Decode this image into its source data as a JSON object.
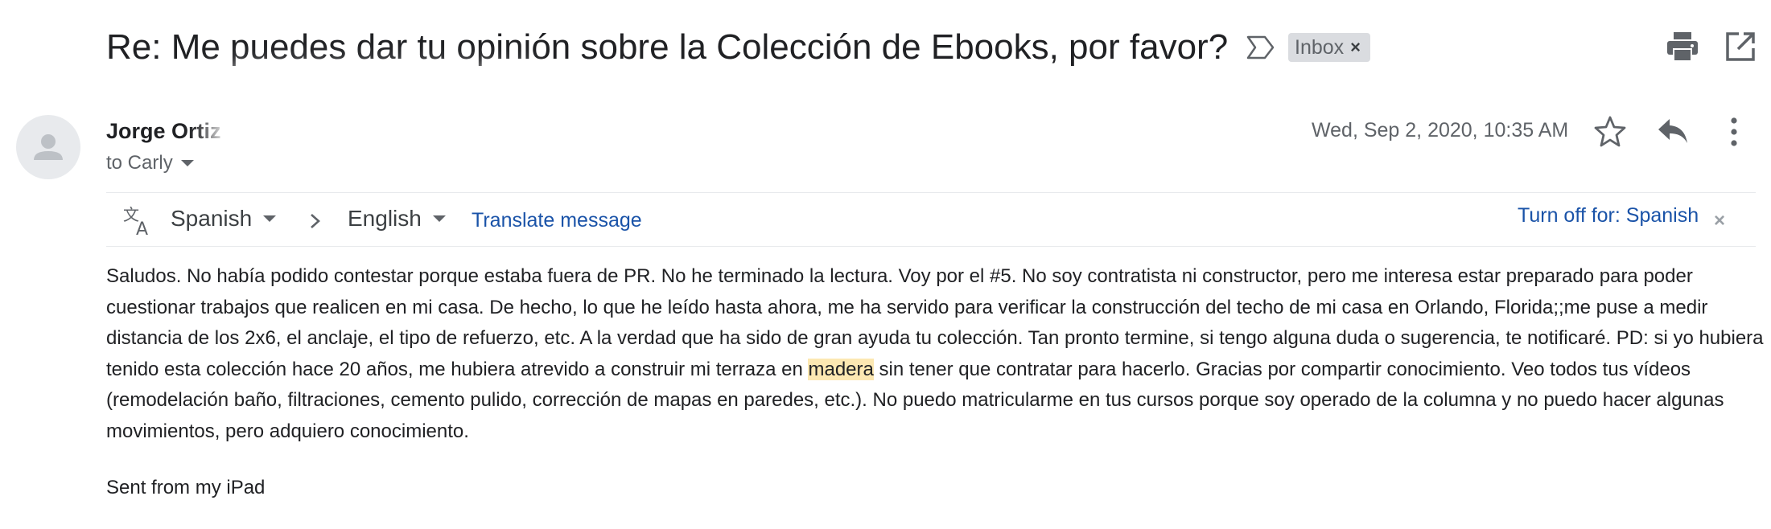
{
  "subject": "Re: Me puedes dar tu opinión sobre la Colección de Ebooks, por favor?",
  "labels": {
    "inbox": "Inbox",
    "remove": "×"
  },
  "icons": {
    "important": "important-marker-icon",
    "print": "print-icon",
    "popout": "open-in-new-window-icon",
    "avatar": "person-icon",
    "star": "star-icon",
    "reply": "reply-icon",
    "more": "more-vert-icon",
    "translate": "translate-icon"
  },
  "sender": {
    "name": "Jorge Ortiz",
    "recipient": "to Carly"
  },
  "date": "Wed, Sep 2, 2020, 10:35 AM",
  "translate_bar": {
    "source_language": "Spanish",
    "target_language": "English",
    "translate_link": "Translate message",
    "turn_off_link": "Turn off for: Spanish",
    "close": "×"
  },
  "body": {
    "before_highlight": "Saludos.  No había podido contestar porque estaba fuera de PR.   No he terminado la lectura.  Voy por el #5.   No soy contratista ni constructor, pero me interesa estar preparado para poder cuestionar trabajos que realicen en mi casa.  De hecho, lo que he leído hasta ahora, me ha servido para verificar la construcción del techo de mi casa en Orlando, Florida;;me puse a medir distancia de los 2x6, el anclaje, el tipo de refuerzo, etc.   A la verdad que ha sido de gran ayuda tu colección.  Tan pronto termine, si tengo alguna duda o sugerencia, te notificaré.    PD:  si yo hubiera tenido esta colección hace 20 años, me hubiera atrevido a construir mi terraza en ",
    "highlight": "madera",
    "after_highlight": " sin tener que contratar para hacerlo.  Gracias por compartir conocimiento.  Veo todos tus vídeos (remodelación baño, filtraciones, cemento pulido, corrección de mapas en paredes, etc.).  No puedo matricularme en tus cursos porque soy operado de la columna y no puedo hacer algunas movimientos, pero adquiero conocimiento.",
    "signature": "Sent from my iPad"
  },
  "colors": {
    "link": "#1a53a8",
    "label_bg": "#dadce0",
    "highlight": "#fce8b2"
  }
}
